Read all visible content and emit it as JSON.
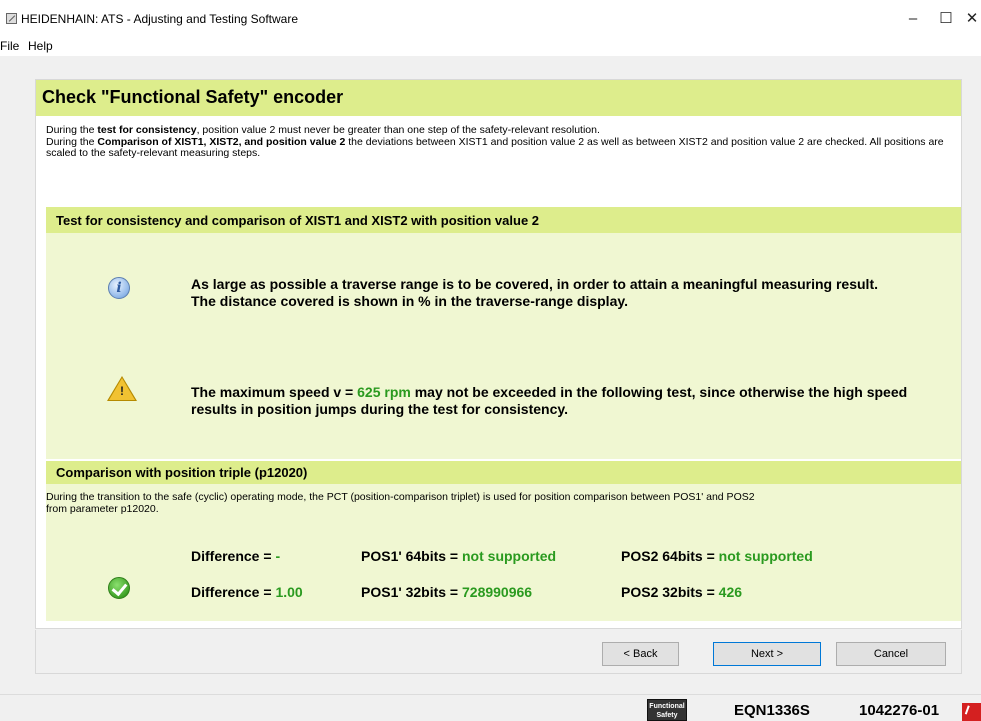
{
  "window": {
    "title": "HEIDENHAIN: ATS - Adjusting and Testing Software",
    "minimize": "–",
    "maximize": "☐",
    "close": "✕"
  },
  "menu": {
    "file": "File",
    "help": "Help"
  },
  "main": {
    "title": "Check \"Functional Safety\" encoder",
    "intro": {
      "p1_a": "During the ",
      "p1_bold": "test for consistency",
      "p1_b": ", position value 2 must never be greater than one step of the safety-relevant resolution.",
      "p2_a": "During the ",
      "p2_bold": "Comparison of XIST1, XIST2, and position value 2",
      "p2_b": " the deviations between XIST1 and position value 2 as well as between XIST2 and position value 2 are checked. All positions are scaled to the safety-relevant measuring steps."
    }
  },
  "section1": {
    "title": "Test for consistency and comparison of XIST1 and XIST2 with position value 2",
    "info_line1": "As large as possible a traverse range is to be covered, in order to attain a meaningful measuring result.",
    "info_line2": "The distance covered is shown in % in the traverse-range display.",
    "warn_pre": "The maximum speed v = ",
    "warn_speed": "625 rpm",
    "warn_post": " may not be exceeded in the following test, since otherwise the high speed results in position jumps during the test for consistency."
  },
  "section2": {
    "title": "Comparison with position triple (p12020)",
    "desc_line1": "During the transition to the safe (cyclic) operating mode, the PCT (position-comparison triplet) is used for position comparison between POS1' and POS2",
    "desc_line2": "from parameter p12020.",
    "row1": {
      "diff_label": "Difference = ",
      "diff_value": "-",
      "pos1_label": "POS1' 64bits = ",
      "pos1_value": "not supported",
      "pos2_label": "POS2 64bits = ",
      "pos2_value": "not supported"
    },
    "row2": {
      "diff_label": "Difference = ",
      "diff_value": "1.00",
      "pos1_label": "POS1' 32bits = ",
      "pos1_value": "728990966",
      "pos2_label": "POS2 32bits = ",
      "pos2_value": "426"
    }
  },
  "buttons": {
    "back": "< Back",
    "next": "Next >",
    "cancel": "Cancel"
  },
  "status": {
    "badge_line1": "Functional",
    "badge_line2": "Safety",
    "encoder": "EQN1336S",
    "serial": "1042276-01"
  },
  "colors": {
    "accent_green": "#dded8c",
    "value_green": "#2a9a1f"
  },
  "icons": [
    "info-icon",
    "warning-icon",
    "check-icon",
    "status-error-icon"
  ]
}
